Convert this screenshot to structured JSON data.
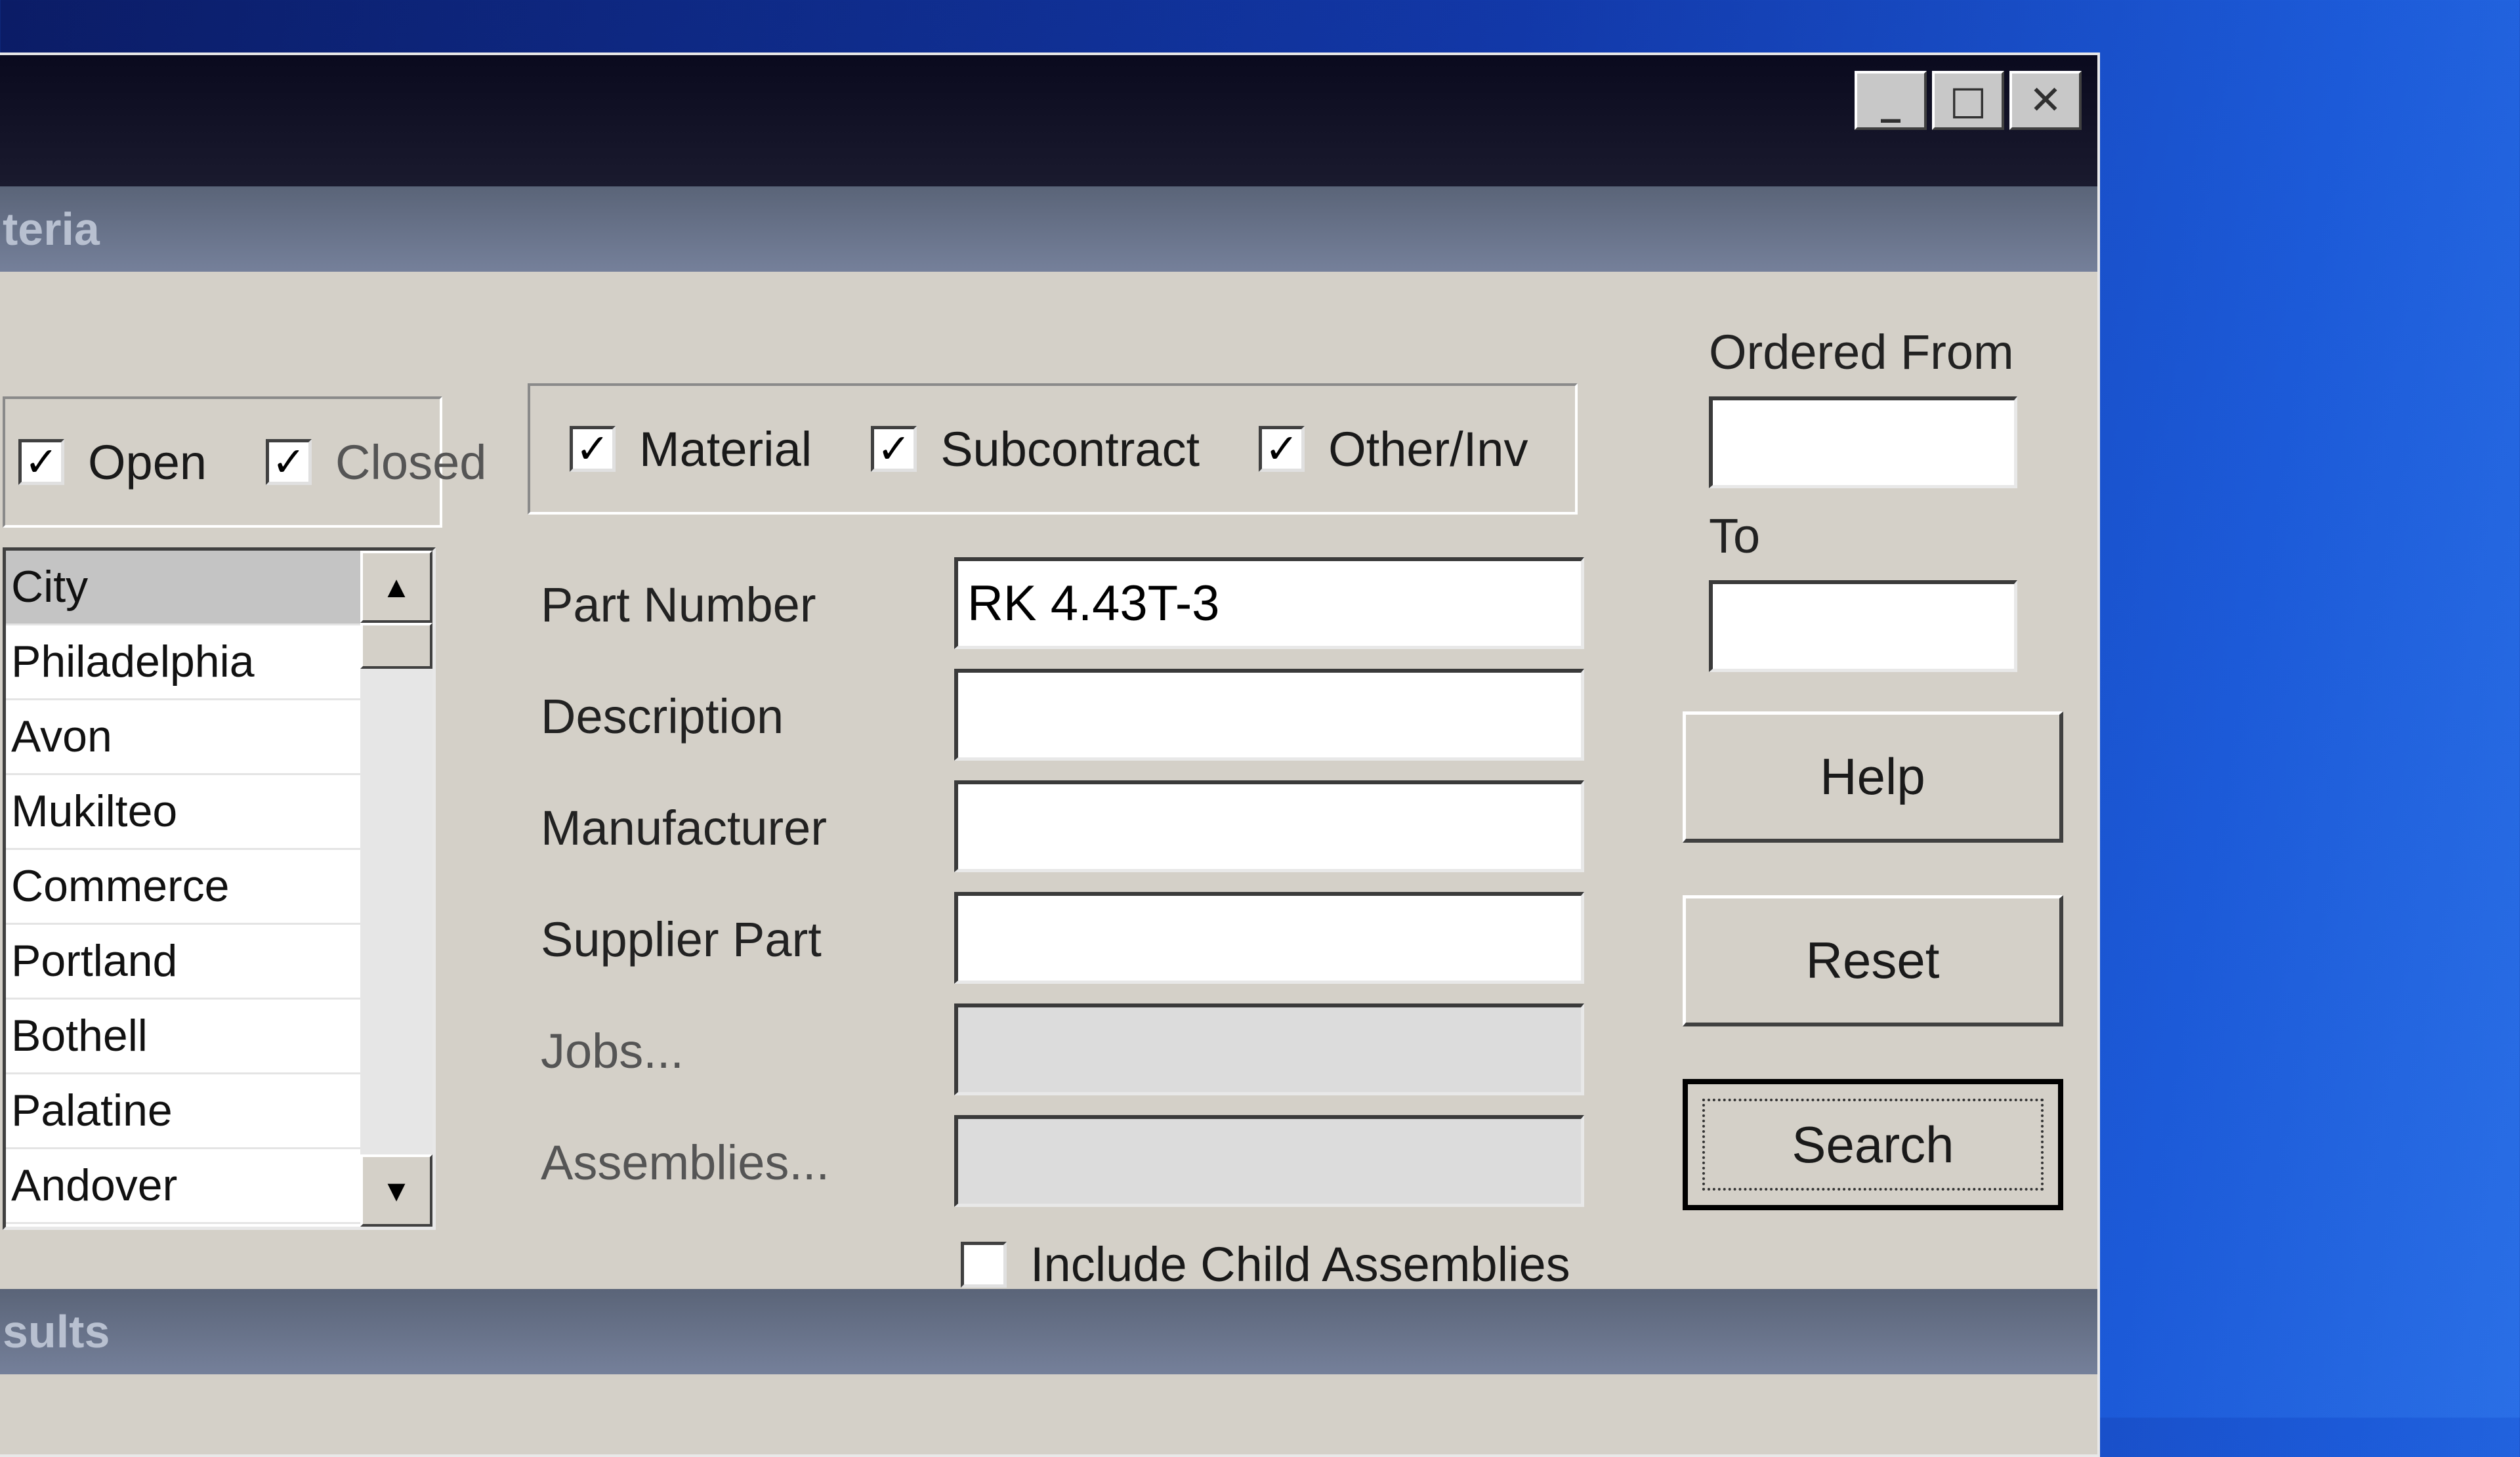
{
  "window": {
    "controls": [
      {
        "name": "minimize",
        "glyph": "_"
      },
      {
        "name": "maximize",
        "glyph": "□"
      },
      {
        "name": "close",
        "glyph": "✕"
      }
    ]
  },
  "criteria_header": "teria",
  "results_header": "sults",
  "status_group": {
    "items": [
      {
        "label": "Open",
        "checked": true
      },
      {
        "label": "Closed",
        "checked": true
      }
    ]
  },
  "type_group": {
    "items": [
      {
        "label": "Material",
        "checked": true
      },
      {
        "label": "Subcontract",
        "checked": true
      },
      {
        "label": "Other/Inv",
        "checked": true
      }
    ]
  },
  "city_list": {
    "items": [
      "City",
      "Philadelphia",
      "Avon",
      "Mukilteo",
      "Commerce",
      "Portland",
      "Bothell",
      "Palatine",
      "Andover"
    ],
    "selected_index": 0,
    "scroll_up_glyph": "▲",
    "scroll_down_glyph": "▼"
  },
  "fields": {
    "part_number": {
      "label": "Part Number",
      "value": "RK 4.43T-3"
    },
    "description": {
      "label": "Description",
      "value": ""
    },
    "manufacturer": {
      "label": "Manufacturer",
      "value": ""
    },
    "supplier_part": {
      "label": "Supplier Part",
      "value": ""
    },
    "jobs": {
      "label": "Jobs...",
      "value": ""
    },
    "assemblies": {
      "label": "Assemblies...",
      "value": ""
    }
  },
  "include_child": {
    "label": "Include Child Assemblies",
    "checked": false
  },
  "ordered_from": {
    "label": "Ordered From",
    "value": ""
  },
  "ordered_to": {
    "label": "To",
    "value": ""
  },
  "buttons": {
    "help": "Help",
    "reset": "Reset",
    "search": "Search"
  },
  "check_glyph": "✓"
}
